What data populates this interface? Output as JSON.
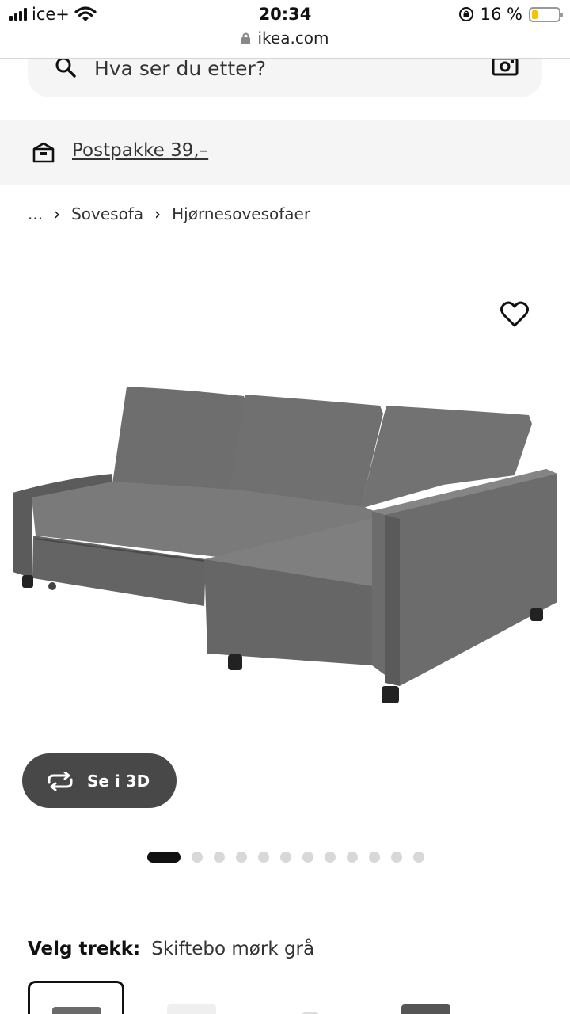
{
  "status_bar": {
    "carrier": "ice+",
    "time": "20:34",
    "battery": "16 %",
    "battery_level": 0.16,
    "url": "ikea.com"
  },
  "search": {
    "placeholder": "Hva ser du etter?"
  },
  "delivery": {
    "label": "Postpakke 39,–"
  },
  "breadcrumb": {
    "ellipsis": "...",
    "items": [
      "Sovesofa",
      "Hjørnesovesofaer"
    ]
  },
  "product": {
    "view_3d_label": "Se i 3D",
    "image_count": 13,
    "active_image": 0,
    "sofa_color": "#6b6b6b"
  },
  "variant": {
    "label": "Velg trekk:",
    "value": "Skiftebo mørk grå"
  },
  "icons": [
    "signal-icon",
    "wifi-icon",
    "lock-icon",
    "search-icon",
    "camera-icon",
    "truck-icon",
    "heart-icon",
    "rotate-3d-icon"
  ]
}
